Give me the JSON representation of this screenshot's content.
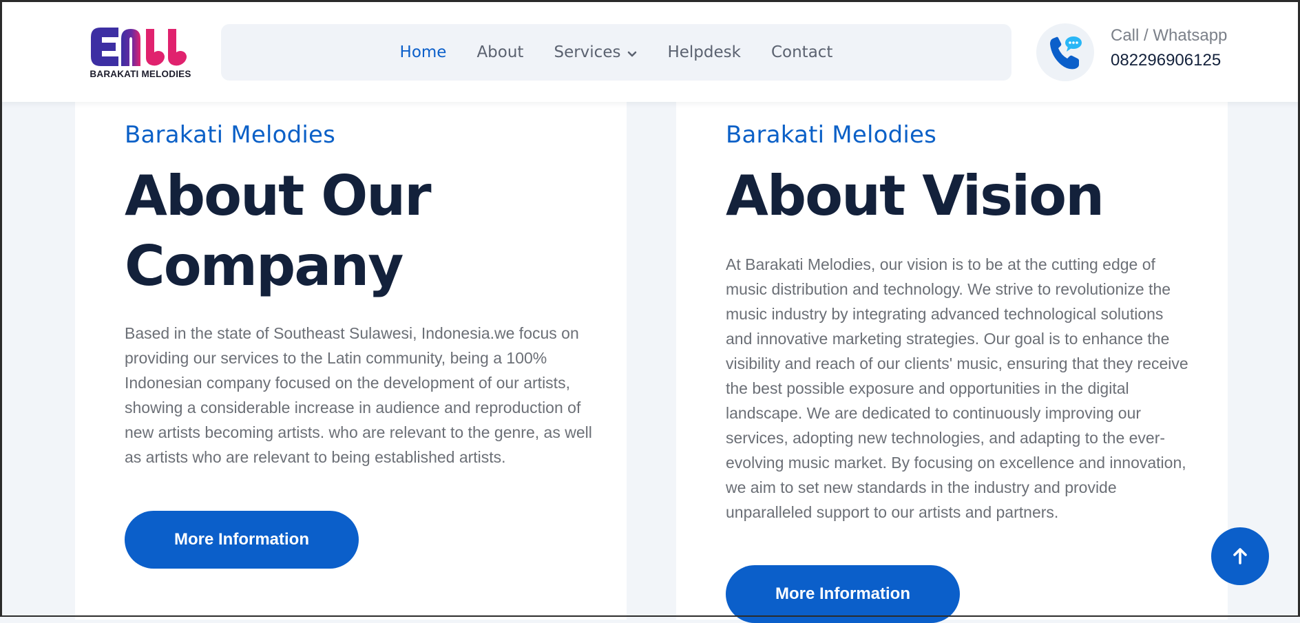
{
  "brand": {
    "name": "BARAKATI MELODIES",
    "colors": {
      "logo_primary": "#3d2fa3",
      "logo_accent": "#e0226e"
    }
  },
  "nav": {
    "items": [
      {
        "label": "Home",
        "active": true
      },
      {
        "label": "About",
        "active": false
      },
      {
        "label": "Services",
        "active": false,
        "has_dropdown": true
      },
      {
        "label": "Helpdesk",
        "active": false
      },
      {
        "label": "Contact",
        "active": false
      }
    ]
  },
  "contact": {
    "label": "Call / Whatsapp",
    "number": "082296906125",
    "icon": "phone-chat-icon"
  },
  "about_company": {
    "eyebrow": "Barakati Melodies",
    "title": "About Our Company",
    "body": "Based in the state of Southeast Sulawesi, Indonesia.we focus on providing our services to the Latin community, being a 100% Indonesian company focused on the development of our artists, showing a considerable increase in audience and reproduction of new artists becoming artists. who are relevant to the genre, as well as artists who are relevant to being established artists.",
    "button_label": "More Information"
  },
  "about_vision": {
    "eyebrow": "Barakati Melodies",
    "title": "About Vision",
    "body": "At Barakati Melodies, our vision is to be at the cutting edge of music distribution and technology. We strive to revolutionize the music industry by integrating advanced technological solutions and innovative marketing strategies. Our goal is to enhance the visibility and reach of our clients' music, ensuring that they receive the best possible exposure and opportunities in the digital landscape. We are dedicated to continuously improving our services, adopting new technologies, and adapting to the ever-evolving music market. By focusing on excellence and innovation, we aim to set new standards in the industry and provide unparalleled support to our artists and partners.",
    "button_label": "More Information"
  },
  "scroll_top": {
    "icon": "arrow-up-icon"
  },
  "theme": {
    "accent": "#0b5fca",
    "heading": "#13213b",
    "body_text": "#6b6f76",
    "page_bg": "#f2f5f9"
  }
}
